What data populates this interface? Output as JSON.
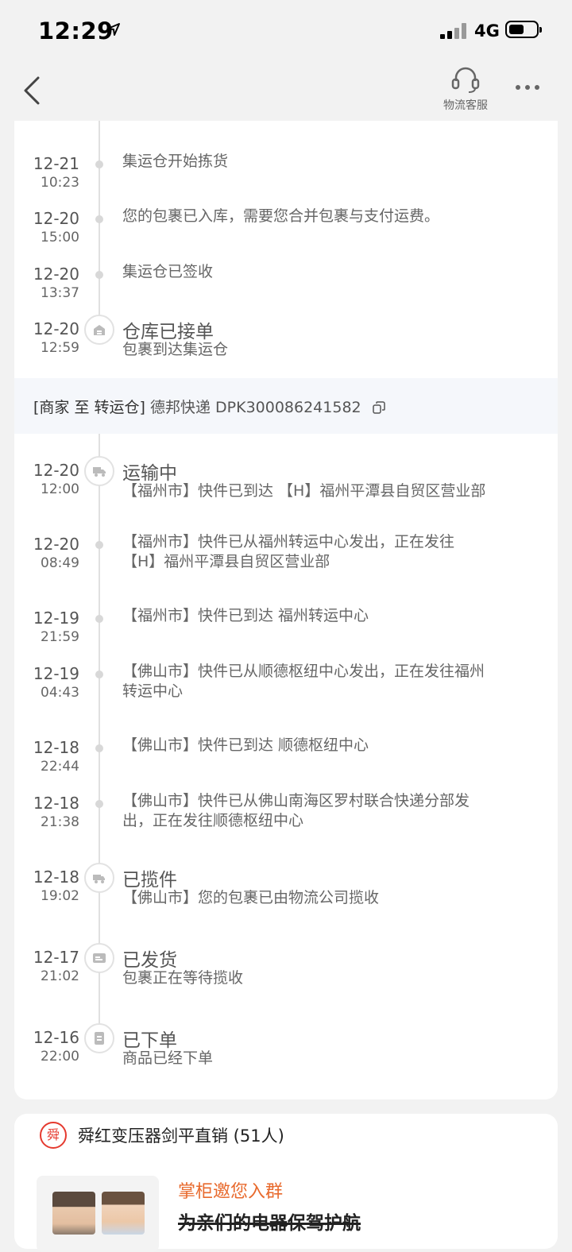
{
  "status": {
    "time": "12:29",
    "network": "4G"
  },
  "nav": {
    "cs_label": "物流客服"
  },
  "top_events": [
    {
      "date": "12-21",
      "time": "10:23",
      "desc": "集运仓开始拣货"
    },
    {
      "date": "12-20",
      "time": "15:00",
      "desc": "您的包裹已入库，需要您合并包裹与支付运费。"
    },
    {
      "date": "12-20",
      "time": "13:37",
      "desc": "集运仓已签收"
    },
    {
      "date": "12-20",
      "time": "12:59",
      "title": "仓库已接单",
      "desc": "包裹到达集运仓"
    }
  ],
  "leg": {
    "segment": "[商家 至 转运仓]",
    "carrier": "德邦快递",
    "tracking": "DPK300086241582"
  },
  "events": [
    {
      "date": "12-20",
      "time": "12:00",
      "title": "运输中",
      "desc": "【福州市】快件已到达 【H】福州平潭县自贸区营业部"
    },
    {
      "date": "12-20",
      "time": "08:49",
      "line1": "【福州市】快件已从福州转运中心发出，正在发往",
      "line2": "【H】福州平潭县自贸区营业部"
    },
    {
      "date": "12-19",
      "time": "21:59",
      "desc": "【福州市】快件已到达 福州转运中心"
    },
    {
      "date": "12-19",
      "time": "04:43",
      "line1": "【佛山市】快件已从顺德枢纽中心发出，正在发往福州",
      "line2": "转运中心"
    },
    {
      "date": "12-18",
      "time": "22:44",
      "desc": "【佛山市】快件已到达 顺德枢纽中心"
    },
    {
      "date": "12-18",
      "time": "21:38",
      "line1": "【佛山市】快件已从佛山南海区罗村联合快递分部发",
      "line2": "出，正在发往顺德枢纽中心"
    },
    {
      "date": "12-18",
      "time": "19:02",
      "title": "已揽件",
      "desc": "【佛山市】您的包裹已由物流公司揽收"
    },
    {
      "date": "12-17",
      "time": "21:02",
      "title": "已发货",
      "desc": "包裹正在等待揽收"
    },
    {
      "date": "12-16",
      "time": "22:00",
      "title": "已下单",
      "desc": "商品已经下单"
    }
  ],
  "shop": {
    "logo": "舜",
    "name": "舜红变压器剑平直销 (51人)",
    "invite_title": "掌柜邀您入群",
    "invite_sub": "为亲们的电器保驾护航"
  },
  "colors": {
    "accent": "#e86a2d",
    "brand_red": "#e53a2f"
  }
}
